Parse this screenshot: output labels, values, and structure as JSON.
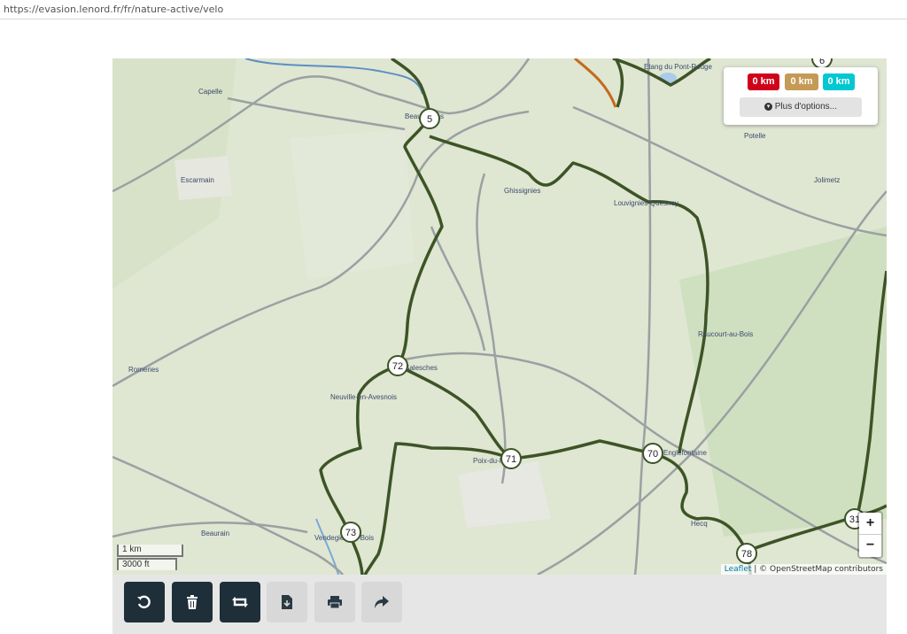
{
  "browser": {
    "url": "https://evasion.lenord.fr/fr/nature-active/velo"
  },
  "colors": {
    "route": "#3d5426",
    "road": "#9ba0a2",
    "land": "#dfe6d2",
    "badge_red": "#d0021b",
    "badge_tan": "#c49a55",
    "badge_cyan": "#00c8d2",
    "button_dark": "#1f2f3a"
  },
  "map": {
    "places": [
      {
        "name": "Capelle"
      },
      {
        "name": "Escarmain"
      },
      {
        "name": "Romeries"
      },
      {
        "name": "Neuville-en-Avesnois"
      },
      {
        "name": "Beaurain"
      },
      {
        "name": "Vendegies-au-Bois"
      },
      {
        "name": "Poix-du-Nord"
      },
      {
        "name": "Ghissignies"
      },
      {
        "name": "Louvignies-Quesnoy"
      },
      {
        "name": "Potelle"
      },
      {
        "name": "Jolimetz"
      },
      {
        "name": "Raucourt-au-Bois"
      },
      {
        "name": "Englefontaine"
      },
      {
        "name": "Hecq"
      },
      {
        "name": "Salesches"
      },
      {
        "name": "Beaudignies"
      },
      {
        "name": "Etang du Pont-Rouge"
      }
    ],
    "nodes": [
      {
        "label": "5"
      },
      {
        "label": "72"
      },
      {
        "label": "71"
      },
      {
        "label": "70"
      },
      {
        "label": "73"
      },
      {
        "label": "78"
      },
      {
        "label": "6"
      },
      {
        "label": "31"
      }
    ],
    "distance_badges": [
      {
        "label": "0 km",
        "color": "#d0021b"
      },
      {
        "label": "0 km",
        "color": "#c49a55"
      },
      {
        "label": "0 km",
        "color": "#00c8d2"
      }
    ],
    "more_options_label": "Plus d'options...",
    "zoom_in_label": "+",
    "zoom_out_label": "−",
    "scale_metric": "1 km",
    "scale_imperial": "3000 ft",
    "attribution_leaflet": "Leaflet",
    "attribution_sep": " | © ",
    "attribution_osm": "OpenStreetMap contributors"
  },
  "toolbar": {
    "buttons": [
      {
        "name": "undo",
        "icon": "undo-icon",
        "active": true
      },
      {
        "name": "delete",
        "icon": "trash-icon",
        "active": true
      },
      {
        "name": "reverse",
        "icon": "retweet-icon",
        "active": true
      },
      {
        "name": "download",
        "icon": "file-download-icon",
        "active": false
      },
      {
        "name": "print",
        "icon": "print-icon",
        "active": false
      },
      {
        "name": "share",
        "icon": "share-icon",
        "active": false
      }
    ]
  }
}
